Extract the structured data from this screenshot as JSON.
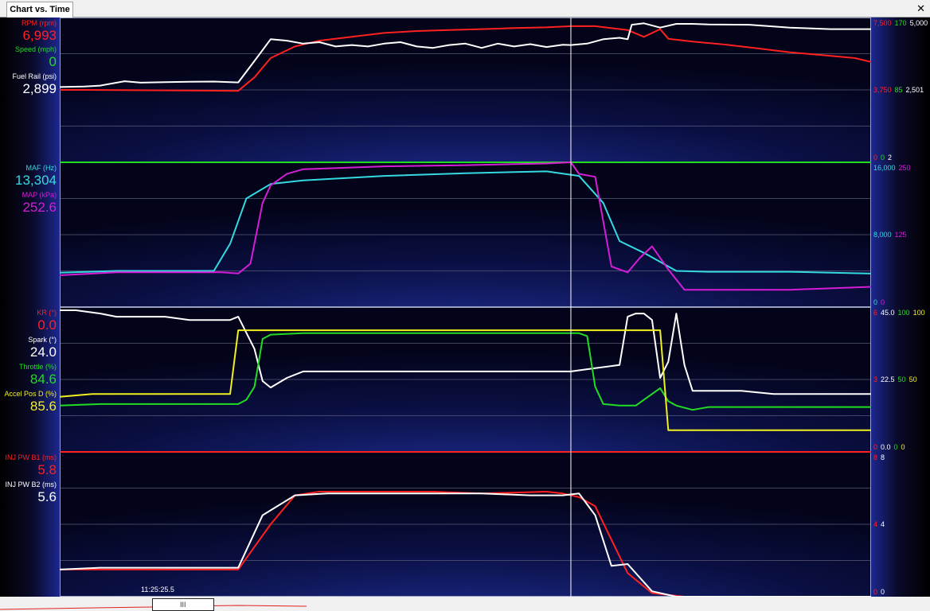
{
  "window": {
    "tab_label": "Chart vs. Time",
    "close_glyph": "✕"
  },
  "colors": {
    "red": "#ff2020",
    "green": "#21dd21",
    "white": "#ffffff",
    "cyan": "#35d9e0",
    "magenta": "#d61dd6",
    "yellow": "#f0f020"
  },
  "panels": [
    {
      "labels": [
        {
          "name": "RPM (rpm)",
          "value": "6,993",
          "color": "#ff2020"
        },
        {
          "name": "Speed (mph)",
          "value": "0",
          "color": "#21dd21"
        },
        {
          "name": "Fuel Rail (psi)",
          "value": "2,899",
          "color": "#ffffff"
        }
      ],
      "scale_top": [
        {
          "text": "7,500",
          "color": "#ff2020"
        },
        {
          "text": "170",
          "color": "#21dd21"
        },
        {
          "text": "5,000",
          "color": "#ffffff"
        }
      ],
      "scale_mid": [
        {
          "text": "3,750",
          "color": "#ff2020"
        },
        {
          "text": "85",
          "color": "#21dd21"
        },
        {
          "text": "2,501",
          "color": "#ffffff"
        }
      ],
      "scale_bot": [
        {
          "text": "0",
          "color": "#ff2020"
        },
        {
          "text": "0",
          "color": "#21dd21"
        },
        {
          "text": "2",
          "color": "#ffffff"
        }
      ]
    },
    {
      "labels": [
        {
          "name": "MAF (Hz)",
          "value": "13,304",
          "color": "#35d9e0"
        },
        {
          "name": "MAP (kPa)",
          "value": "252.6",
          "color": "#d61dd6"
        }
      ],
      "scale_top": [
        {
          "text": "16,000",
          "color": "#35d9e0"
        },
        {
          "text": "250",
          "color": "#d61dd6"
        }
      ],
      "scale_mid": [
        {
          "text": "8,000",
          "color": "#35d9e0"
        },
        {
          "text": "125",
          "color": "#d61dd6"
        }
      ],
      "scale_bot": [
        {
          "text": "0",
          "color": "#35d9e0"
        },
        {
          "text": "0",
          "color": "#d61dd6"
        }
      ]
    },
    {
      "labels": [
        {
          "name": "KR (°)",
          "value": "0.0",
          "color": "#ff2020"
        },
        {
          "name": "Spark (°)",
          "value": "24.0",
          "color": "#ffffff"
        },
        {
          "name": "Throttle (%)",
          "value": "84.6",
          "color": "#21dd21"
        },
        {
          "name": "Accel Pos D (%)",
          "value": "85.6",
          "color": "#f0f020"
        }
      ],
      "scale_top": [
        {
          "text": "6",
          "color": "#ff2020"
        },
        {
          "text": "45.0",
          "color": "#ffffff"
        },
        {
          "text": "100",
          "color": "#21dd21"
        },
        {
          "text": "100",
          "color": "#f0f020"
        }
      ],
      "scale_mid": [
        {
          "text": "3",
          "color": "#ff2020"
        },
        {
          "text": "22.5",
          "color": "#ffffff"
        },
        {
          "text": "50",
          "color": "#21dd21"
        },
        {
          "text": "50",
          "color": "#f0f020"
        }
      ],
      "scale_bot": [
        {
          "text": "0",
          "color": "#ff2020"
        },
        {
          "text": "0.0",
          "color": "#ffffff"
        },
        {
          "text": "0",
          "color": "#21dd21"
        },
        {
          "text": "0",
          "color": "#f0f020"
        }
      ]
    },
    {
      "labels": [
        {
          "name": "INJ PW B1 (ms)",
          "value": "5.8",
          "color": "#ff2020"
        },
        {
          "name": "INJ PW B2 (ms)",
          "value": "5.6",
          "color": "#ffffff"
        }
      ],
      "scale_top": [
        {
          "text": "8",
          "color": "#ff2020"
        },
        {
          "text": "8",
          "color": "#ffffff"
        }
      ],
      "scale_mid": [
        {
          "text": "4",
          "color": "#ff2020"
        },
        {
          "text": "4",
          "color": "#ffffff"
        }
      ],
      "scale_bot": [
        {
          "text": "0",
          "color": "#ff2020"
        },
        {
          "text": "0",
          "color": "#ffffff"
        }
      ]
    }
  ],
  "chart_data": {
    "type": "line",
    "cursor_fraction": 0.63,
    "panels": [
      {
        "series": [
          {
            "name": "RPM (rpm)",
            "color": "#ff2020",
            "min": 0,
            "max": 7500,
            "x": [
              0,
              0.03,
              0.22,
              0.24,
              0.26,
              0.29,
              0.32,
              0.36,
              0.4,
              0.44,
              0.48,
              0.52,
              0.56,
              0.6,
              0.63,
              0.66,
              0.7,
              0.72,
              0.74,
              0.75,
              0.78,
              0.82,
              0.86,
              0.9,
              0.94,
              0.98,
              1
            ],
            "y": [
              3750,
              3750,
              3700,
              4400,
              5400,
              6000,
              6300,
              6500,
              6700,
              6800,
              6850,
              6900,
              6950,
              6990,
              7050,
              7050,
              6850,
              6500,
              6900,
              6400,
              6250,
              6100,
              5900,
              5700,
              5550,
              5400,
              5200
            ]
          },
          {
            "name": "Speed (mph)",
            "color": "#21dd21",
            "min": 0,
            "max": 170,
            "x": [
              0,
              1
            ],
            "y": [
              0,
              0
            ]
          },
          {
            "name": "Fuel Rail (psi)",
            "color": "#ffffff",
            "min": 2,
            "max": 5000,
            "x": [
              0,
              0.03,
              0.05,
              0.08,
              0.1,
              0.13,
              0.16,
              0.19,
              0.22,
              0.24,
              0.26,
              0.28,
              0.3,
              0.32,
              0.34,
              0.36,
              0.38,
              0.4,
              0.42,
              0.44,
              0.46,
              0.48,
              0.5,
              0.52,
              0.54,
              0.56,
              0.58,
              0.6,
              0.62,
              0.63,
              0.65,
              0.67,
              0.69,
              0.7,
              0.705,
              0.72,
              0.74,
              0.76,
              0.78,
              0.8,
              0.85,
              0.9,
              0.95,
              1
            ],
            "y": [
              2600,
              2620,
              2650,
              2800,
              2750,
              2770,
              2780,
              2790,
              2760,
              3500,
              4250,
              4200,
              4100,
              4150,
              4000,
              4050,
              4000,
              4100,
              4150,
              4000,
              3950,
              4050,
              4100,
              3950,
              4100,
              4000,
              4080,
              3980,
              4060,
              4050,
              4100,
              4250,
              4300,
              4250,
              4750,
              4800,
              4650,
              4780,
              4780,
              4760,
              4750,
              4650,
              4600,
              4600
            ]
          }
        ]
      },
      {
        "series": [
          {
            "name": "MAF (Hz)",
            "color": "#35d9e0",
            "min": 0,
            "max": 16000,
            "x": [
              0,
              0.07,
              0.19,
              0.21,
              0.23,
              0.26,
              0.3,
              0.4,
              0.5,
              0.6,
              0.64,
              0.67,
              0.69,
              0.72,
              0.76,
              0.8,
              0.9,
              1
            ],
            "y": [
              3800,
              4000,
              4000,
              7000,
              12000,
              13600,
              14000,
              14500,
              14800,
              15000,
              14500,
              11500,
              7300,
              6000,
              4000,
              3900,
              3900,
              3700
            ]
          },
          {
            "name": "MAP (kPa)",
            "color": "#d61dd6",
            "min": 0,
            "max": 250,
            "x": [
              0,
              0.07,
              0.2,
              0.22,
              0.235,
              0.25,
              0.26,
              0.28,
              0.3,
              0.4,
              0.5,
              0.6,
              0.63,
              0.64,
              0.66,
              0.68,
              0.7,
              0.715,
              0.73,
              0.75,
              0.77,
              0.8,
              0.9,
              1
            ],
            "y": [
              55,
              60,
              60,
              58,
              75,
              180,
              210,
              230,
              238,
              243,
              245,
              248,
              250,
              230,
              225,
              70,
              60,
              85,
              105,
              65,
              30,
              30,
              30,
              35
            ]
          }
        ]
      },
      {
        "series": [
          {
            "name": "KR (°)",
            "color": "#ff2020",
            "min": 0,
            "max": 6,
            "x": [
              0,
              1
            ],
            "y": [
              0,
              0
            ]
          },
          {
            "name": "Spark (°)",
            "color": "#ffffff",
            "min": 0,
            "max": 45,
            "x": [
              0,
              0.02,
              0.05,
              0.07,
              0.1,
              0.13,
              0.16,
              0.19,
              0.21,
              0.22,
              0.24,
              0.25,
              0.26,
              0.28,
              0.3,
              0.35,
              0.4,
              0.45,
              0.5,
              0.55,
              0.6,
              0.63,
              0.66,
              0.69,
              0.7,
              0.71,
              0.72,
              0.73,
              0.74,
              0.75,
              0.76,
              0.77,
              0.78,
              0.8,
              0.84,
              0.88,
              0.92,
              0.96,
              1
            ],
            "y": [
              44,
              44,
              43,
              42,
              42,
              42,
              41,
              41,
              41,
              42,
              32,
              22,
              20,
              23,
              25,
              25,
              25,
              25,
              25,
              25,
              25,
              25,
              26,
              27,
              42,
              43,
              43,
              41,
              23,
              28,
              43,
              27,
              19,
              19,
              19,
              18,
              18,
              18,
              18
            ]
          },
          {
            "name": "Throttle (%)",
            "color": "#21dd21",
            "min": 0,
            "max": 100,
            "x": [
              0,
              0.05,
              0.1,
              0.15,
              0.2,
              0.22,
              0.23,
              0.24,
              0.25,
              0.26,
              0.3,
              0.4,
              0.5,
              0.6,
              0.64,
              0.65,
              0.66,
              0.67,
              0.69,
              0.71,
              0.73,
              0.74,
              0.75,
              0.76,
              0.78,
              0.8,
              0.9,
              1
            ],
            "y": [
              32,
              33,
              33,
              33,
              33,
              33,
              36,
              45,
              78,
              81,
              82,
              82,
              82,
              82,
              82,
              80,
              45,
              33,
              32,
              32,
              40,
              44,
              35,
              32,
              29,
              31,
              31,
              31
            ]
          },
          {
            "name": "Accel Pos D (%)",
            "color": "#f0f020",
            "min": 0,
            "max": 100,
            "x": [
              0,
              0.04,
              0.08,
              0.12,
              0.16,
              0.2,
              0.21,
              0.22,
              0.3,
              0.4,
              0.5,
              0.6,
              0.66,
              0.69,
              0.72,
              0.74,
              0.75,
              0.8,
              0.9,
              1
            ],
            "y": [
              38,
              40,
              40,
              40,
              40,
              40,
              40,
              84,
              84,
              84,
              84,
              84,
              84,
              84,
              84,
              84,
              15,
              15,
              15,
              15
            ]
          }
        ]
      },
      {
        "series": [
          {
            "name": "INJ PW B1 (ms)",
            "color": "#ff2020",
            "min": 0,
            "max": 8,
            "x": [
              0,
              0.1,
              0.2,
              0.22,
              0.26,
              0.29,
              0.32,
              0.38,
              0.46,
              0.52,
              0.6,
              0.62,
              0.64,
              0.66,
              0.7,
              0.73,
              0.77,
              0.8,
              1
            ],
            "y": [
              1.5,
              1.5,
              1.5,
              1.5,
              4.0,
              5.6,
              5.8,
              5.8,
              5.8,
              5.7,
              5.8,
              5.7,
              5.5,
              5.0,
              1.3,
              0.2,
              -1,
              -1,
              -1
            ]
          },
          {
            "name": "INJ PW B2 (ms)",
            "color": "#ffffff",
            "min": 0,
            "max": 8,
            "x": [
              0,
              0.05,
              0.1,
              0.15,
              0.21,
              0.22,
              0.25,
              0.29,
              0.33,
              0.38,
              0.46,
              0.52,
              0.58,
              0.62,
              0.64,
              0.66,
              0.68,
              0.7,
              0.73,
              0.76,
              0.8,
              1
            ],
            "y": [
              1.5,
              1.6,
              1.6,
              1.6,
              1.6,
              1.6,
              4.5,
              5.6,
              5.7,
              5.7,
              5.7,
              5.7,
              5.6,
              5.6,
              5.7,
              4.5,
              1.7,
              1.8,
              0.3,
              -1,
              -1,
              -1
            ]
          }
        ]
      }
    ]
  },
  "footer": {
    "time_label": "11:25:25.5",
    "scroll_grip": "III"
  }
}
